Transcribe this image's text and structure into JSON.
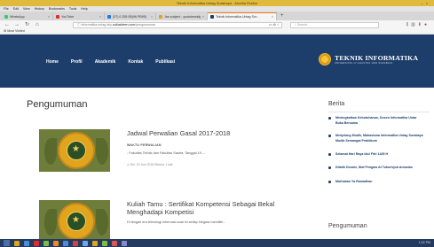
{
  "window": {
    "title": "Teknik Informatika Untag Surabaya - Mozilla Firefox"
  },
  "menu": [
    "File",
    "Edit",
    "View",
    "History",
    "Bookmarks",
    "Tools",
    "Help"
  ],
  "tabs": [
    {
      "label": "WhatsApp",
      "color": "#25d366"
    },
    {
      "label": "YouTube",
      "color": "#e52d27"
    },
    {
      "label": "(37) 0 255 0B(96 PB95)",
      "color": "#1877f2"
    },
    {
      "label": "Jan subject - youtubewidget",
      "color": "#e0a51d"
    },
    {
      "label": "Teknik Informatika Untag Sur...",
      "color": "#1d3d6b",
      "active": true
    }
  ],
  "address": {
    "prefix": "informatika.untag-sby.",
    "domain": "outhaideen.com",
    "path": "/pengumuman",
    "actions": "••• ✿ ☆",
    "search_placeholder": "Search"
  },
  "bookmarks": {
    "label": "Most Visited"
  },
  "site": {
    "nav": [
      "Home",
      "Profil",
      "Akademik",
      "Kontak",
      "Publikasi"
    ],
    "brand_title": "TEKNIK INFORMATIKA",
    "brand_subtitle": "UNIVERSITAS 17 AGUSTUS 1945 SURABAYA",
    "colors": {
      "primary": "#1d3d6b",
      "accent": "#e0a51d"
    }
  },
  "main": {
    "title": "Pengumuman",
    "posts": [
      {
        "title": "Jadwal Perwalian Gasal 2017-2018",
        "meta": "WAKTU PERWALIAN",
        "excerpt": "- Fakultas Teknik dan Fakultas Sastra, Tanggal 19 -...",
        "info": "Sel. 22 Juni 2018   Dibaca: 1 kali"
      },
      {
        "title": "Kuliah Tamu : Sertifikat Kompetensi Sebagai Bekal Menghadapi Kompetisi",
        "excerpt": "Di tengah era teknologi informasi saat ini setiap Negara memiliki..."
      }
    ]
  },
  "sidebar": {
    "berita_title": "Berita",
    "items": [
      "Meningkatkan Kebutuhanan, Dosen Informatika Untar Buka Bersama",
      "Menjelang Mudik, Mahasiswa Informatika Untag Surabaya Mudik Semangat Praktikum",
      "Selamat Hari Raya Idul Fitri 1439 H",
      "Dilatih Desain, Staf Pengaw At Tukorivjob Antusias",
      "Marhaban Ya Ramadhan"
    ],
    "pengumuman_title": "Pengumuman"
  },
  "taskbar": {
    "clock": "1:02 PM",
    "apps": [
      "#e0a51d",
      "#4a90d9",
      "#e52d27",
      "#7fbf3f",
      "#f08a24",
      "#4a90d9",
      "#c44",
      "#6aa8e8",
      "#e0a51d",
      "#7fbf3f",
      "#d55",
      "#88c"
    ]
  }
}
